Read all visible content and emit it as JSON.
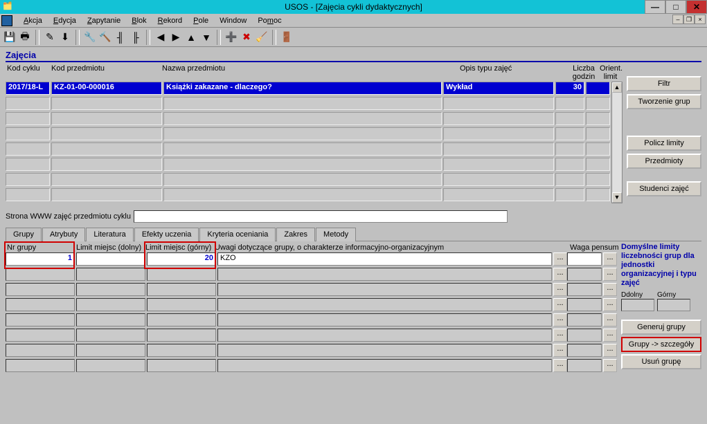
{
  "window": {
    "title": "USOS - [Zajęcia cykli dydaktycznych]"
  },
  "menu": {
    "akcja": "Akcja",
    "edycja": "Edycja",
    "zapytanie": "Zapytanie",
    "blok": "Blok",
    "rekord": "Rekord",
    "pole": "Pole",
    "window": "Window",
    "pomoc": "Pomoc"
  },
  "section": {
    "zajecia": "Zajęcia"
  },
  "gridHeaders": {
    "kodCyklu": "Kod cyklu",
    "kodPrzedmiotu": "Kod przedmiotu",
    "nazwaPrzedmiotu": "Nazwa przedmiotu",
    "opisTypu": "Opis typu zajęć",
    "liczbaGodzin": "Liczba godzin",
    "orientLimit": "Orient. limit"
  },
  "gridRow": {
    "kodCyklu": "2017/18-L",
    "kodPrzedmiotu": "KZ-01-00-000016",
    "nazwa": "Książki zakazane - dlaczego?",
    "opis": "Wykład",
    "liczba": "30",
    "orient": ""
  },
  "sideButtons": {
    "filtr": "Filtr",
    "tworzenie": "Tworzenie grup",
    "policz": "Policz limity",
    "przedmioty": "Przedmioty",
    "studenci": "Studenci zajęć"
  },
  "www": {
    "label": "Strona WWW zajęć przedmiotu cyklu",
    "value": ""
  },
  "tabs": {
    "grupy": "Grupy",
    "atrybuty": "Atrybuty",
    "literatura": "Literatura",
    "efekty": "Efekty uczenia",
    "kryteria": "Kryteria oceniania",
    "zakres": "Zakres",
    "metody": "Metody"
  },
  "lgHeaders": {
    "nrGrupy": "Nr grupy",
    "limitDolny": "Limit miejsc (dolny)",
    "limitGorny": "Limit miejsc (górny)",
    "uwagi": "Uwagi dotyczące grupy, o charakterze informacyjno-organizacyjnym",
    "waga": "Waga pensum"
  },
  "lgRow": {
    "nr": "1",
    "dolny": "",
    "gorny": "20",
    "uwagi": "KZO",
    "waga": ""
  },
  "lowerSide": {
    "info": "Domyślne limity liczebności grup dla jednostki organizacyjnej i typu zajęć",
    "ddolny": "Ddolny",
    "gorny": "Górny",
    "generuj": "Generuj grupy",
    "szczegoly": "Grupy -> szczegóły",
    "usun": "Usuń grupę"
  },
  "ellipsis": "..."
}
